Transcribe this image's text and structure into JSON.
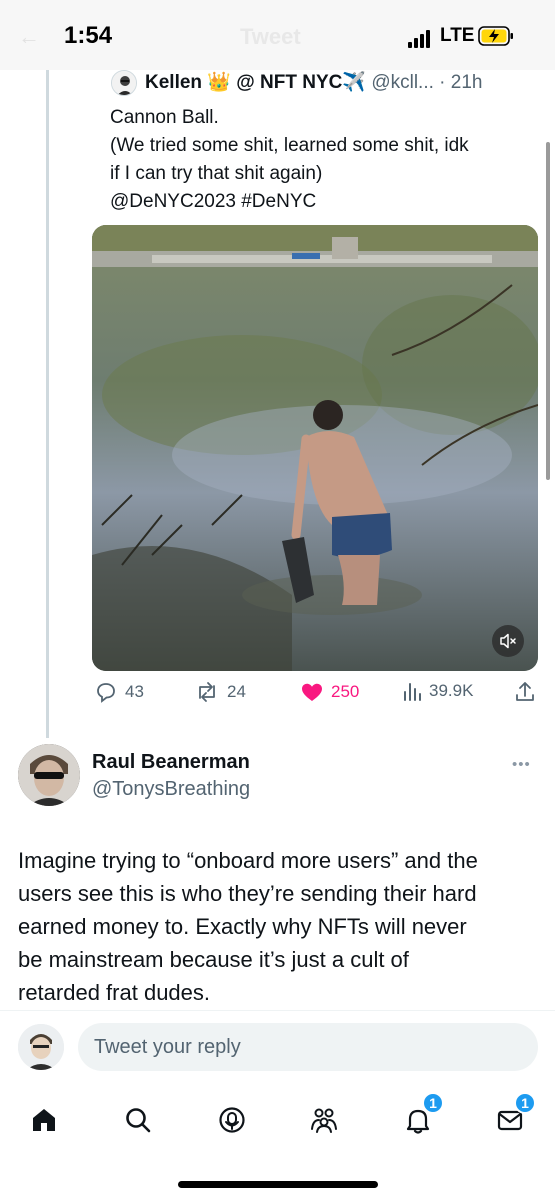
{
  "status_bar": {
    "time": "1:54",
    "network": "LTE",
    "faded_title": "Tweet"
  },
  "quoted_tweet": {
    "author_name": "Kellen 👑 @ NFT NYC✈️",
    "handle_time": "@kcll... · 21h",
    "text_lines": [
      "Cannon Ball.",
      "(We tried some shit, learned some shit, idk",
      "if I can try that shit again)",
      "@DeNYC2023 #DeNYC"
    ],
    "media_icon": "mute-icon",
    "actions": {
      "replies": "43",
      "retweets": "24",
      "likes": "250",
      "views": "39.9K"
    }
  },
  "reply": {
    "author_name": "Raul Beanerman",
    "handle": "@TonysBreathing",
    "more": "•••",
    "text_lines": [
      "Imagine trying to “onboard more users” and the",
      "users see this is who they’re sending their hard",
      "earned money to. Exactly why NFTs will never",
      "be mainstream because it’s just a cult of",
      "retarded frat dudes."
    ]
  },
  "compose": {
    "placeholder": "Tweet your reply"
  },
  "tab_bar": {
    "items": [
      "home-icon",
      "search-icon",
      "spaces-icon",
      "communities-icon",
      "notifications-icon",
      "messages-icon"
    ],
    "notifications_badge": "1",
    "messages_badge": "1"
  },
  "colors": {
    "accent": "#1d9bf0",
    "like": "#f91880",
    "secondary_text": "#536471"
  }
}
